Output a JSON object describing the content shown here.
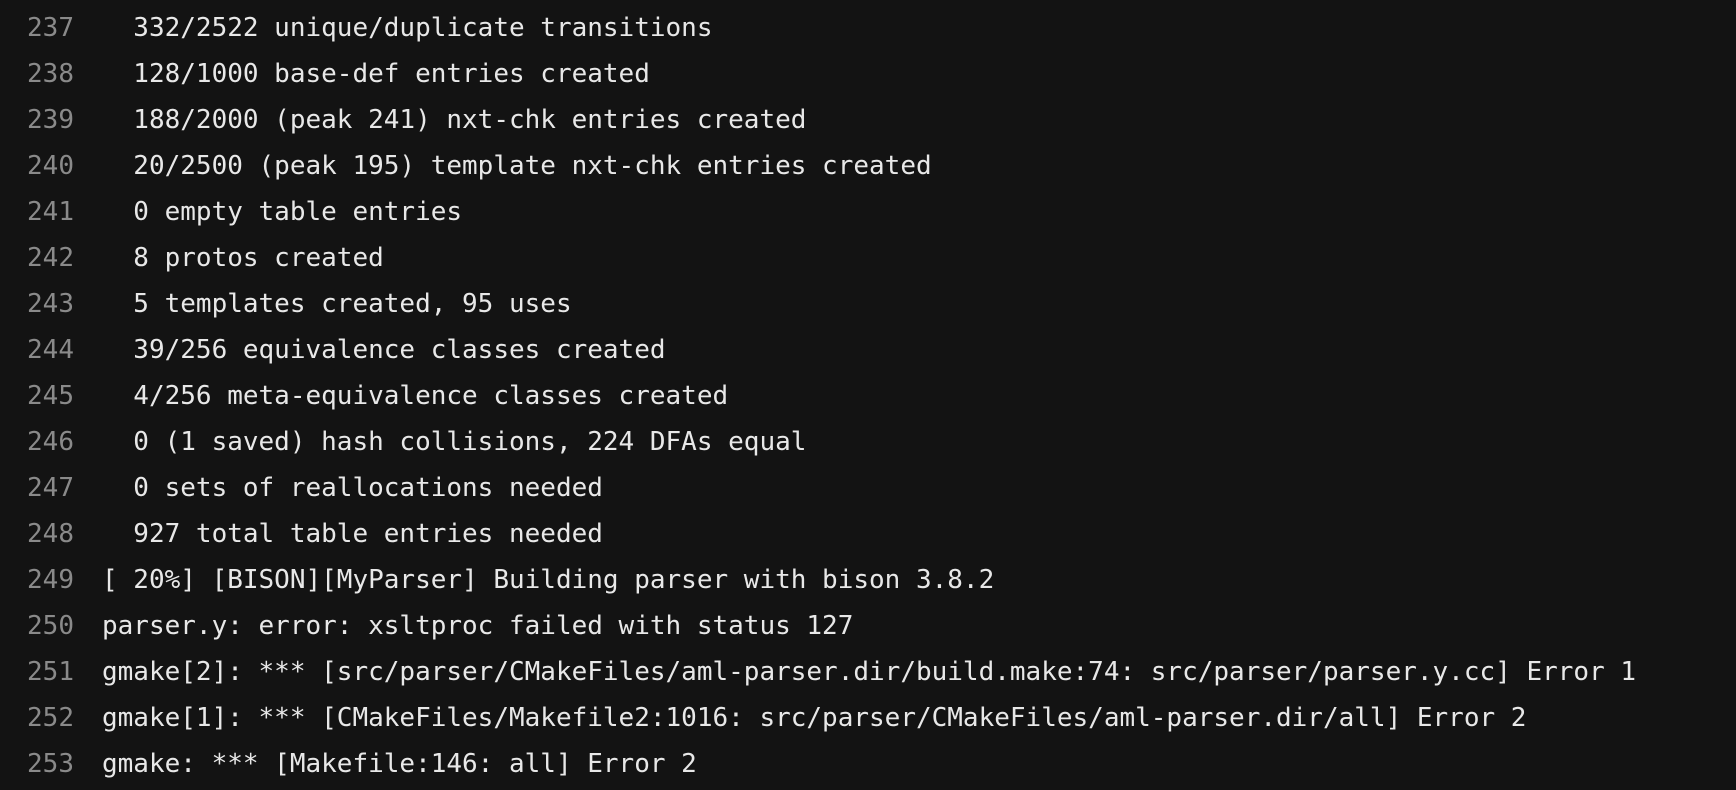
{
  "log": {
    "lines": [
      {
        "number": "237",
        "text": "  332/2522 unique/duplicate transitions"
      },
      {
        "number": "238",
        "text": "  128/1000 base-def entries created"
      },
      {
        "number": "239",
        "text": "  188/2000 (peak 241) nxt-chk entries created"
      },
      {
        "number": "240",
        "text": "  20/2500 (peak 195) template nxt-chk entries created"
      },
      {
        "number": "241",
        "text": "  0 empty table entries"
      },
      {
        "number": "242",
        "text": "  8 protos created"
      },
      {
        "number": "243",
        "text": "  5 templates created, 95 uses"
      },
      {
        "number": "244",
        "text": "  39/256 equivalence classes created"
      },
      {
        "number": "245",
        "text": "  4/256 meta-equivalence classes created"
      },
      {
        "number": "246",
        "text": "  0 (1 saved) hash collisions, 224 DFAs equal"
      },
      {
        "number": "247",
        "text": "  0 sets of reallocations needed"
      },
      {
        "number": "248",
        "text": "  927 total table entries needed"
      },
      {
        "number": "249",
        "text": "[ 20%] [BISON][MyParser] Building parser with bison 3.8.2"
      },
      {
        "number": "250",
        "text": "parser.y: error: xsltproc failed with status 127"
      },
      {
        "number": "251",
        "text": "gmake[2]: *** [src/parser/CMakeFiles/aml-parser.dir/build.make:74: src/parser/parser.y.cc] Error 1"
      },
      {
        "number": "252",
        "text": "gmake[1]: *** [CMakeFiles/Makefile2:1016: src/parser/CMakeFiles/aml-parser.dir/all] Error 2"
      },
      {
        "number": "253",
        "text": "gmake: *** [Makefile:146: all] Error 2"
      }
    ]
  }
}
